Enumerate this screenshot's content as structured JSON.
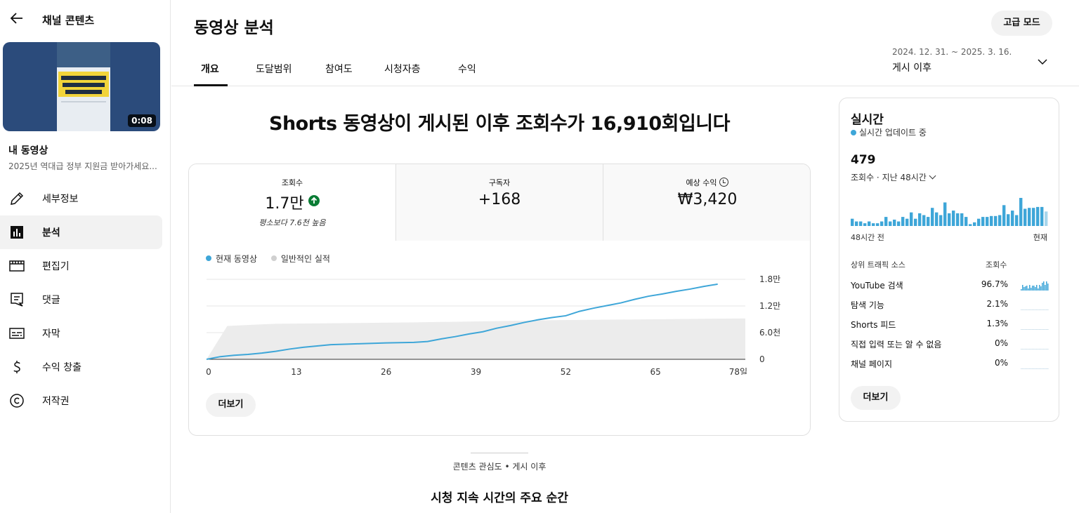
{
  "sidebar": {
    "title": "채널 콘텐츠",
    "video": {
      "duration": "0:08",
      "heading": "내 동영상",
      "description": "2025년 역대급 정부 지원금 받아가세요..."
    },
    "items": [
      {
        "label": "세부정보",
        "icon": "pencil-icon"
      },
      {
        "label": "분석",
        "icon": "analytics-icon"
      },
      {
        "label": "편집기",
        "icon": "editor-icon"
      },
      {
        "label": "댓글",
        "icon": "comments-icon"
      },
      {
        "label": "자막",
        "icon": "subtitles-icon"
      },
      {
        "label": "수익 창출",
        "icon": "dollar-icon"
      },
      {
        "label": "저작권",
        "icon": "copyright-icon"
      }
    ]
  },
  "header": {
    "title": "동영상 분석",
    "advanced_mode": "고급 모드",
    "tabs": [
      "개요",
      "도달범위",
      "참여도",
      "시청자층",
      "수익"
    ],
    "date_range": "2024. 12. 31. ~ 2025. 3. 16.",
    "date_label": "게시 이후"
  },
  "main": {
    "headline": "Shorts 동영상이 게시된 이후 조회수가 16,910회입니다",
    "metrics": [
      {
        "label": "조회수",
        "value": "1.7만",
        "note": "평소보다 7.6천 높음"
      },
      {
        "label": "구독자",
        "value": "+168"
      },
      {
        "label": "예상 수익",
        "value": "₩3,420"
      }
    ],
    "legend": {
      "current": "현재 동영상",
      "typical": "일반적인 실적"
    },
    "more_label": "더보기",
    "interest_label": "콘텐츠 관심도 • 게시 이후",
    "key_moments": "시청 지속 시간의 주요 순간"
  },
  "chart_data": {
    "type": "line",
    "x_ticks": [
      "0",
      "13",
      "26",
      "39",
      "52",
      "65",
      "78일"
    ],
    "y_ticks": [
      "1.8만",
      "1.2만",
      "6.0천",
      "0"
    ],
    "ylim": [
      0,
      18000
    ],
    "xlim": [
      0,
      78
    ],
    "series": [
      {
        "name": "현재 동영상",
        "color": "#3ea6d8",
        "x": [
          0,
          2,
          4,
          6,
          8,
          10,
          12,
          14,
          16,
          18,
          20,
          22,
          24,
          26,
          28,
          30,
          32,
          34,
          36,
          38,
          40,
          42,
          44,
          46,
          48,
          50,
          52,
          54,
          56,
          58,
          60,
          62,
          64,
          66,
          68,
          70,
          72,
          74
        ],
        "y": [
          0,
          600,
          900,
          1100,
          1400,
          1800,
          2300,
          2700,
          3000,
          3300,
          3400,
          3500,
          3600,
          3700,
          3750,
          3800,
          4000,
          4600,
          5100,
          5700,
          6200,
          7000,
          7600,
          8300,
          8900,
          9400,
          9800,
          10800,
          11500,
          12100,
          12700,
          13500,
          14200,
          14700,
          15300,
          15800,
          16400,
          16910
        ]
      },
      {
        "name": "일반적인 실적",
        "color": "#d8d8d8",
        "x": [
          0,
          3,
          10,
          30,
          50,
          78
        ],
        "y_low": [
          0,
          0,
          0,
          0,
          0,
          0
        ],
        "y_high": [
          0,
          7500,
          8000,
          8300,
          8800,
          9200
        ]
      }
    ]
  },
  "realtime": {
    "title": "실시간",
    "status": "실시간 업데이트 중",
    "count": "479",
    "subtitle": "조회수 · 지난 48시간",
    "bars": [
      8,
      5,
      5,
      3,
      5,
      3,
      3,
      5,
      10,
      5,
      7,
      5,
      10,
      8,
      15,
      8,
      14,
      12,
      10,
      20,
      15,
      12,
      26,
      14,
      17,
      14,
      14,
      10,
      2,
      4,
      8,
      10,
      10,
      11,
      11,
      12,
      23,
      13,
      17,
      12,
      31,
      19,
      20,
      20,
      21,
      21,
      16
    ],
    "left_label": "48시간 전",
    "right_label": "현재",
    "table_header_source": "상위 트래픽 소스",
    "table_header_views": "조회수",
    "sources": [
      {
        "name": "YouTube 검색",
        "pct": "96.7%"
      },
      {
        "name": "탐색 기능",
        "pct": "2.1%"
      },
      {
        "name": "Shorts 피드",
        "pct": "1.3%"
      },
      {
        "name": "직접 입력 또는 알 수 없음",
        "pct": "0%"
      },
      {
        "name": "채널 페이지",
        "pct": "0%"
      }
    ],
    "more_label": "더보기"
  }
}
